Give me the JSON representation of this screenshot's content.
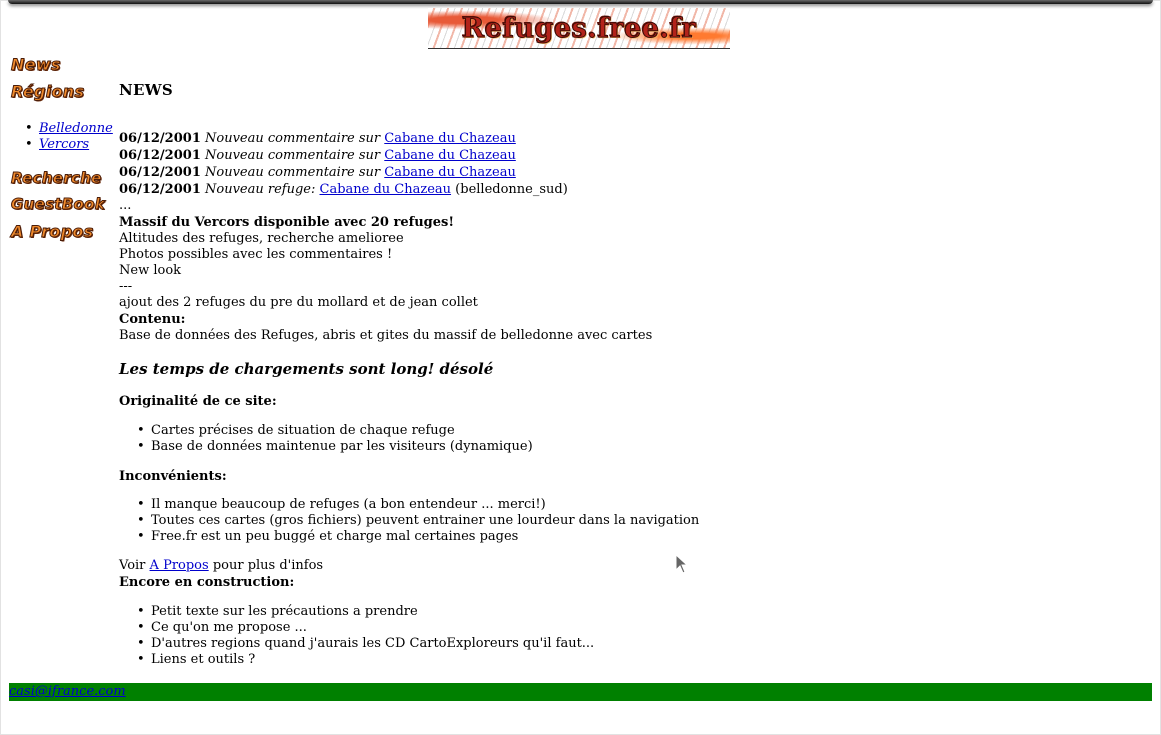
{
  "header": {
    "logo_text": "Refuges.free.fr"
  },
  "sidebar": {
    "nav": [
      {
        "label": "News"
      },
      {
        "label": "Régions"
      },
      {
        "label": "Recherche"
      },
      {
        "label": "GuestBook"
      },
      {
        "label": "A Propos"
      }
    ],
    "regions": [
      "Belledonne",
      "Vercors"
    ]
  },
  "main": {
    "heading": "NEWS",
    "news": [
      {
        "date": "06/12/2001",
        "text": "Nouveau commentaire sur",
        "link": "Cabane du Chazeau",
        "suffix": ""
      },
      {
        "date": "06/12/2001",
        "text": "Nouveau commentaire sur",
        "link": "Cabane du Chazeau",
        "suffix": ""
      },
      {
        "date": "06/12/2001",
        "text": "Nouveau commentaire sur",
        "link": "Cabane du Chazeau",
        "suffix": ""
      },
      {
        "date": "06/12/2001",
        "text": "Nouveau refuge:",
        "link": "Cabane du Chazeau",
        "suffix": "(belledonne_sud)"
      }
    ],
    "ellipsis": "...",
    "vercors_title": "Massif du Vercors disponible avec 20 refuges!",
    "updates": [
      "Altitudes des refuges, recherche amelioree",
      "Photos possibles avec les commentaires !",
      "New look",
      "---",
      "ajout des 2 refuges du pre du mollard et de jean collet"
    ],
    "contenu_label": "Contenu:",
    "contenu_text": "Base de données des Refuges, abris et gites du massif de belledonne avec cartes",
    "loading_note": "Les temps de chargements sont long! désolé",
    "originalite_label": "Originalité de ce site:",
    "originalite_items": [
      "Cartes précises de situation de chaque refuge",
      "Base de données maintenue par les visiteurs (dynamique)"
    ],
    "inconvenients_label": "Inconvénients:",
    "inconvenients_items": [
      "Il manque beaucoup de refuges (a bon entendeur ... merci!)",
      "Toutes ces cartes (gros fichiers) peuvent entrainer une lourdeur dans la navigation",
      "Free.fr est un peu buggé et charge mal certaines pages"
    ],
    "voir_prefix": "Voir",
    "voir_link": "A Propos",
    "voir_suffix": "pour plus d'infos",
    "construction_label": "Encore en construction:",
    "construction_items": [
      "Petit texte sur les précautions a prendre",
      "Ce qu'on me propose ...",
      "D'autres regions quand j'aurais les CD CartoExploreurs qu'il faut...",
      "Liens et outils ?"
    ]
  },
  "footer": {
    "email": "casi@ifrance.com",
    "bar_color": "#008000"
  }
}
